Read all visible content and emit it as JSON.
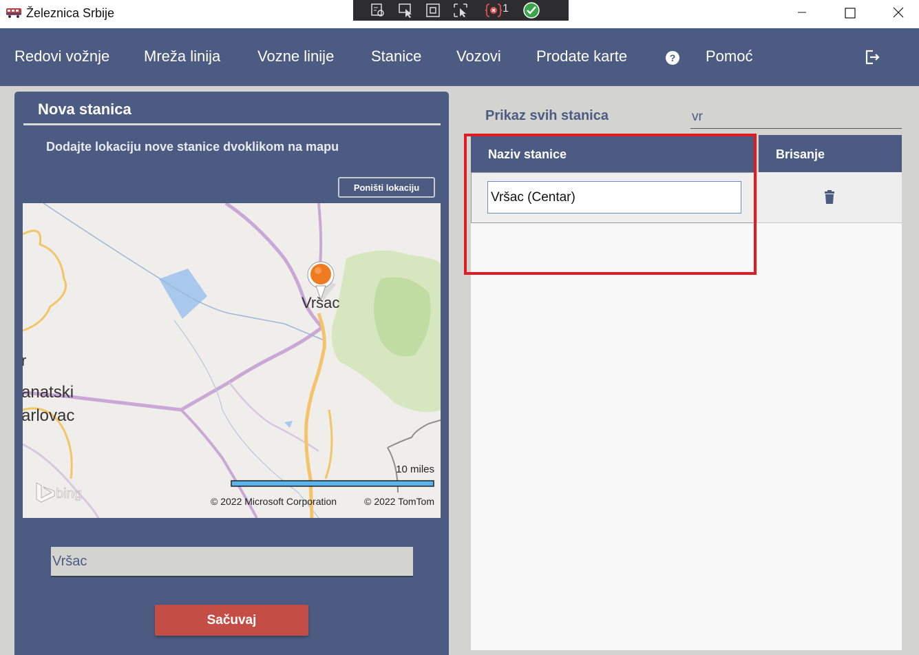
{
  "window": {
    "title": "Železnica Srbije",
    "debug_error_count": "1",
    "app_icon": "train-icon"
  },
  "nav": {
    "items": [
      "Redovi vožnje",
      "Mreža linija",
      "Vozne linije",
      "Stanice",
      "Vozovi",
      "Prodate karte"
    ],
    "help_label": "Pomoć",
    "help_icon": "question-circle-icon",
    "logout_icon": "logout-icon"
  },
  "new_station": {
    "title": "Nova stanica",
    "instruction": "Dodajte lokaciju nove stanice dvoklikom na mapu",
    "reset_label": "Poništi lokaciju",
    "map": {
      "pin_label": "Vršac",
      "place_labels": [
        "r",
        "anatski",
        "arlovac"
      ],
      "scale_label": "10 miles",
      "logo_label": "bing",
      "copyright_ms": "© 2022 Microsoft Corporation",
      "copyright_tt": "© 2022 TomTom"
    },
    "name_value": "Vršac",
    "save_label": "Sačuvaj"
  },
  "stations": {
    "title": "Prikaz svih stanica",
    "search_value": "vr",
    "columns": [
      "Naziv stanice",
      "Brisanje"
    ],
    "rows": [
      {
        "name": "Vršac (Centar)",
        "delete_icon": "trash-icon"
      }
    ]
  },
  "colors": {
    "primary": "#4b5b82",
    "background": "#d3d3cf",
    "save": "#c44d45",
    "highlight": "#e01b24"
  }
}
